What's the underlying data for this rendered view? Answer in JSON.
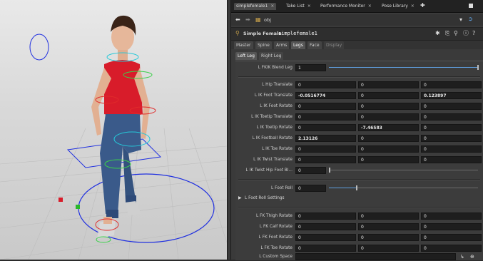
{
  "tabs": [
    {
      "label": "simplefemale1",
      "active": true
    },
    {
      "label": "Take List",
      "active": false
    },
    {
      "label": "Performance Monitor",
      "active": false
    },
    {
      "label": "Pose Library",
      "active": false
    }
  ],
  "path": {
    "context": "obj"
  },
  "node": {
    "type_label": "Simple Female",
    "name": "simplefemale1"
  },
  "param_tabs": [
    {
      "label": "Master",
      "state": "normal"
    },
    {
      "label": "Spine",
      "state": "normal"
    },
    {
      "label": "Arms",
      "state": "normal"
    },
    {
      "label": "Legs",
      "state": "active"
    },
    {
      "label": "Face",
      "state": "normal"
    },
    {
      "label": "Display",
      "state": "dim"
    }
  ],
  "sub_tabs": [
    {
      "label": "Left Leg",
      "active": true
    },
    {
      "label": "Right Leg",
      "active": false
    }
  ],
  "params": {
    "fkik_blend": {
      "label": "L FKIK Blend Leg",
      "value": "1",
      "slider_fraction": 1.0
    },
    "hip_translate": {
      "label": "L Hip Translate",
      "values": [
        "0",
        "0",
        "0"
      ]
    },
    "ik_foot_translate": {
      "label": "L IK Foot Translate",
      "values": [
        "-0.0516774",
        "0",
        "0.123897"
      ]
    },
    "ik_foot_rotate": {
      "label": "L IK Foot Rotate",
      "values": [
        "0",
        "0",
        "0"
      ]
    },
    "ik_toetip_translate": {
      "label": "L IK Toetip Translate",
      "values": [
        "0",
        "0",
        "0"
      ]
    },
    "ik_toetip_rotate": {
      "label": "L IK Toetip Rotate",
      "values": [
        "0",
        "-7.46583",
        "0"
      ]
    },
    "ik_football_rotate": {
      "label": "L IK Football Rotate",
      "values": [
        "2.13126",
        "0",
        "0"
      ]
    },
    "ik_toe_rotate": {
      "label": "L IK Toe Rotate",
      "values": [
        "0",
        "0",
        "0"
      ]
    },
    "ik_twist_translate": {
      "label": "L IK Twist Translate",
      "values": [
        "0",
        "0",
        "0"
      ]
    },
    "ik_twist_hip_foot": {
      "label": "L IK Twist Hip Foot Bl...",
      "value": "0",
      "slider_fraction": 0.0
    },
    "foot_roll": {
      "label": "L Foot Roll",
      "value": "0",
      "slider_fraction": 0.5
    },
    "foot_roll_settings": {
      "label": "L Foot Roll Settings"
    },
    "fk_thigh_rotate": {
      "label": "L FK Thigh Rotate",
      "values": [
        "0",
        "0",
        "0"
      ]
    },
    "fk_calf_rotate": {
      "label": "L FK Calf Rotate",
      "values": [
        "0",
        "0",
        "0"
      ]
    },
    "fk_foot_rotate": {
      "label": "L FK Foot Rotate",
      "values": [
        "0",
        "0",
        "0"
      ]
    },
    "fk_toe_rotate": {
      "label": "L FK Toe Rotate",
      "values": [
        "0",
        "0",
        "0"
      ]
    },
    "custom_space": {
      "label": "L Custom Space",
      "value": ""
    }
  },
  "colors": {
    "accent": "#5fa0e0",
    "panel_bg": "#3a3a3a",
    "field_bg": "#1e1e1e",
    "viewport_bg": "#d9d9d9"
  }
}
